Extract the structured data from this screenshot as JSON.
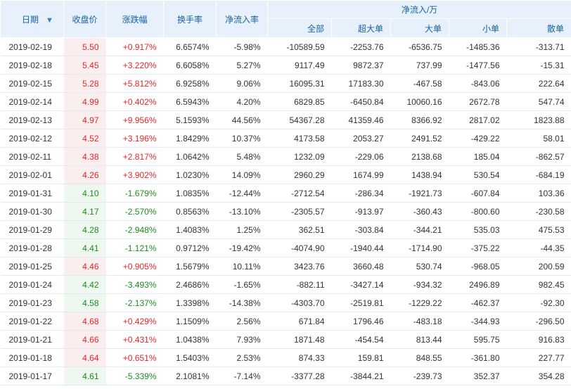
{
  "headers": {
    "date": "日期",
    "sort_icon": "sort-desc",
    "close": "收盘价",
    "change": "涨跌幅",
    "turnover": "换手率",
    "net_inflow_rate": "净流入率",
    "net_inflow_group": "净流入/万",
    "all": "全部",
    "super_large": "超大单",
    "large": "大单",
    "small": "小单",
    "retail": "散单"
  },
  "colors": {
    "up": "#e2262d",
    "down": "#1b8b1f",
    "header_bg": "#e6f1fb",
    "header_text": "#1a5fa8"
  },
  "rows": [
    {
      "date": "2019-02-19",
      "close": "5.50",
      "change": "+0.917%",
      "turnover": "6.6574%",
      "rate": "-5.98%",
      "all": "-10589.59",
      "super": "-2253.76",
      "large": "-6536.75",
      "small": "-1485.36",
      "retail": "-313.71",
      "dir": "up"
    },
    {
      "date": "2019-02-18",
      "close": "5.45",
      "change": "+3.220%",
      "turnover": "6.6058%",
      "rate": "5.27%",
      "all": "9117.49",
      "super": "9872.37",
      "large": "737.99",
      "small": "-1477.56",
      "retail": "-15.31",
      "dir": "up"
    },
    {
      "date": "2019-02-15",
      "close": "5.28",
      "change": "+5.812%",
      "turnover": "6.9258%",
      "rate": "9.06%",
      "all": "16095.31",
      "super": "17183.30",
      "large": "-467.58",
      "small": "-843.06",
      "retail": "222.64",
      "dir": "up"
    },
    {
      "date": "2019-02-14",
      "close": "4.99",
      "change": "+0.402%",
      "turnover": "6.5943%",
      "rate": "4.20%",
      "all": "6829.85",
      "super": "-6450.84",
      "large": "10060.16",
      "small": "2672.78",
      "retail": "547.74",
      "dir": "up"
    },
    {
      "date": "2019-02-13",
      "close": "4.97",
      "change": "+9.956%",
      "turnover": "5.1593%",
      "rate": "44.56%",
      "all": "54367.28",
      "super": "41359.46",
      "large": "8366.92",
      "small": "2817.02",
      "retail": "1823.88",
      "dir": "up"
    },
    {
      "date": "2019-02-12",
      "close": "4.52",
      "change": "+3.196%",
      "turnover": "1.8429%",
      "rate": "10.37%",
      "all": "4173.58",
      "super": "2053.27",
      "large": "2491.52",
      "small": "-429.22",
      "retail": "58.01",
      "dir": "up"
    },
    {
      "date": "2019-02-11",
      "close": "4.38",
      "change": "+2.817%",
      "turnover": "1.0642%",
      "rate": "5.48%",
      "all": "1232.09",
      "super": "-229.06",
      "large": "2138.68",
      "small": "185.04",
      "retail": "-862.57",
      "dir": "up"
    },
    {
      "date": "2019-02-01",
      "close": "4.26",
      "change": "+3.902%",
      "turnover": "1.0230%",
      "rate": "14.09%",
      "all": "2960.29",
      "super": "1674.99",
      "large": "1438.94",
      "small": "530.54",
      "retail": "-684.19",
      "dir": "up"
    },
    {
      "date": "2019-01-31",
      "close": "4.10",
      "change": "-1.679%",
      "turnover": "1.0835%",
      "rate": "-12.44%",
      "all": "-2712.54",
      "super": "-286.34",
      "large": "-1921.73",
      "small": "-607.84",
      "retail": "103.36",
      "dir": "down"
    },
    {
      "date": "2019-01-30",
      "close": "4.17",
      "change": "-2.570%",
      "turnover": "0.8563%",
      "rate": "-13.10%",
      "all": "-2305.57",
      "super": "-913.97",
      "large": "-360.43",
      "small": "-800.60",
      "retail": "-230.58",
      "dir": "down"
    },
    {
      "date": "2019-01-29",
      "close": "4.28",
      "change": "-2.948%",
      "turnover": "1.4083%",
      "rate": "1.25%",
      "all": "362.51",
      "super": "-303.84",
      "large": "-344.21",
      "small": "535.03",
      "retail": "475.53",
      "dir": "down"
    },
    {
      "date": "2019-01-28",
      "close": "4.41",
      "change": "-1.121%",
      "turnover": "0.9712%",
      "rate": "-19.42%",
      "all": "-4074.90",
      "super": "-1940.44",
      "large": "-1714.90",
      "small": "-375.22",
      "retail": "-44.35",
      "dir": "down"
    },
    {
      "date": "2019-01-25",
      "close": "4.46",
      "change": "+0.905%",
      "turnover": "1.5679%",
      "rate": "10.11%",
      "all": "3423.76",
      "super": "3660.48",
      "large": "530.74",
      "small": "-968.05",
      "retail": "200.59",
      "dir": "up"
    },
    {
      "date": "2019-01-24",
      "close": "4.42",
      "change": "-3.493%",
      "turnover": "2.4686%",
      "rate": "-1.65%",
      "all": "-882.11",
      "super": "-3427.14",
      "large": "-934.32",
      "small": "2496.89",
      "retail": "982.45",
      "dir": "down"
    },
    {
      "date": "2019-01-23",
      "close": "4.58",
      "change": "-2.137%",
      "turnover": "1.3398%",
      "rate": "-14.38%",
      "all": "-4303.70",
      "super": "-2519.81",
      "large": "-1229.22",
      "small": "-462.37",
      "retail": "-92.30",
      "dir": "down"
    },
    {
      "date": "2019-01-22",
      "close": "4.68",
      "change": "+0.429%",
      "turnover": "1.1509%",
      "rate": "2.56%",
      "all": "671.84",
      "super": "1796.46",
      "large": "-483.18",
      "small": "-344.93",
      "retail": "-296.50",
      "dir": "up"
    },
    {
      "date": "2019-01-21",
      "close": "4.66",
      "change": "+0.431%",
      "turnover": "1.0438%",
      "rate": "7.93%",
      "all": "1871.48",
      "super": "-454.54",
      "large": "813.44",
      "small": "595.75",
      "retail": "916.83",
      "dir": "up"
    },
    {
      "date": "2019-01-18",
      "close": "4.64",
      "change": "+0.651%",
      "turnover": "1.5403%",
      "rate": "2.53%",
      "all": "874.33",
      "super": "159.81",
      "large": "848.55",
      "small": "-361.80",
      "retail": "227.77",
      "dir": "up"
    },
    {
      "date": "2019-01-17",
      "close": "4.61",
      "change": "-5.339%",
      "turnover": "2.1081%",
      "rate": "-7.14%",
      "all": "-3377.28",
      "super": "-3844.21",
      "large": "-239.73",
      "small": "352.37",
      "retail": "354.28",
      "dir": "down"
    }
  ]
}
